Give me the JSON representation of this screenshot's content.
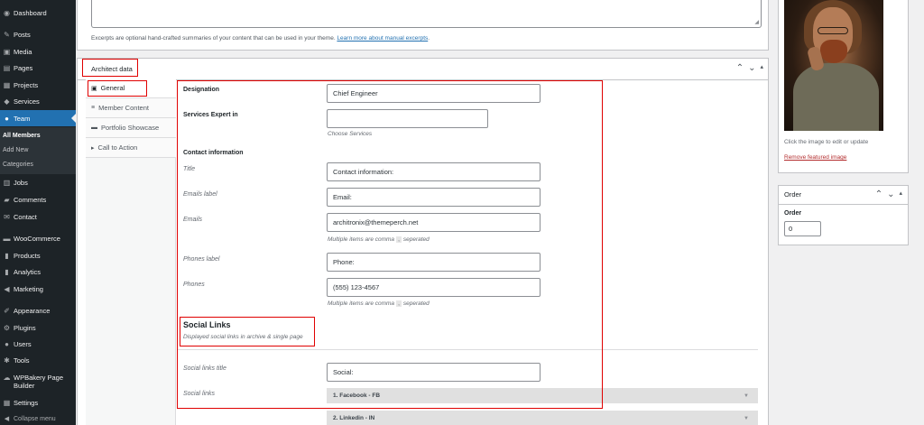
{
  "sidebar": {
    "items": [
      {
        "icon": "dashboard-icon",
        "glyph": "◉",
        "label": "Dashboard"
      },
      {
        "icon": "pin-icon",
        "glyph": "✎",
        "label": "Posts"
      },
      {
        "icon": "media-icon",
        "glyph": "▣",
        "label": "Media"
      },
      {
        "icon": "pages-icon",
        "glyph": "▤",
        "label": "Pages"
      },
      {
        "icon": "projects-icon",
        "glyph": "▦",
        "label": "Projects"
      },
      {
        "icon": "services-icon",
        "glyph": "◆",
        "label": "Services"
      },
      {
        "icon": "team-icon",
        "glyph": "●",
        "label": "Team"
      },
      {
        "icon": "jobs-icon",
        "glyph": "▥",
        "label": "Jobs"
      },
      {
        "icon": "comments-icon",
        "glyph": "▰",
        "label": "Comments"
      },
      {
        "icon": "contact-icon",
        "glyph": "✉",
        "label": "Contact"
      },
      {
        "icon": "woocommerce-icon",
        "glyph": "▬",
        "label": "WooCommerce"
      },
      {
        "icon": "products-icon",
        "glyph": "▮",
        "label": "Products"
      },
      {
        "icon": "analytics-icon",
        "glyph": "▮",
        "label": "Analytics"
      },
      {
        "icon": "marketing-icon",
        "glyph": "◀",
        "label": "Marketing"
      },
      {
        "icon": "appearance-icon",
        "glyph": "✐",
        "label": "Appearance"
      },
      {
        "icon": "plugins-icon",
        "glyph": "⚙",
        "label": "Plugins"
      },
      {
        "icon": "users-icon",
        "glyph": "●",
        "label": "Users"
      },
      {
        "icon": "tools-icon",
        "glyph": "✱",
        "label": "Tools"
      },
      {
        "icon": "wpbakery-icon",
        "glyph": "☁",
        "label": "WPBakery Page Builder"
      },
      {
        "icon": "settings-icon",
        "glyph": "▦",
        "label": "Settings"
      }
    ],
    "submenu": [
      "All Members",
      "Add New",
      "Categories"
    ],
    "collapse_label": "Collapse menu"
  },
  "excerpt": {
    "help_text": "Excerpts are optional hand-crafted summaries of your content that can be used in your theme.",
    "help_link": "Learn more about manual excerpts"
  },
  "metabox": {
    "title": "Architect data",
    "controls": [
      "⌃",
      "⌄",
      "▴"
    ]
  },
  "tabs": [
    {
      "icon": "general-icon",
      "glyph": "▣",
      "label": "General"
    },
    {
      "icon": "member-content-icon",
      "glyph": "≡",
      "label": "Member Content"
    },
    {
      "icon": "portfolio-icon",
      "glyph": "▬",
      "label": "Portfolio Showcase"
    },
    {
      "icon": "call-to-action-icon",
      "glyph": "▸",
      "label": "Call to Action"
    }
  ],
  "fields": {
    "designation_label": "Designation",
    "designation_value": "Chief Engineer",
    "services_label": "Services Expert in",
    "services_hint": "Choose Services",
    "contact_heading": "Contact information",
    "title_label": "Title",
    "title_value": "Contact information:",
    "emails_label_label": "Emails label",
    "emails_label_value": "Email:",
    "emails_label": "Emails",
    "emails_value": "architronix@themeperch.net",
    "emails_hint_pre": "Multiple items are comma",
    "emails_hint_key": ",",
    "emails_hint_post": "seperated",
    "phones_label_label": "Phones label",
    "phones_label_value": "Phone:",
    "phones_label": "Phones",
    "phones_value": "(555) 123-4567",
    "phones_hint_pre": "Multiple items are comma",
    "phones_hint_key": ",",
    "phones_hint_post": "seperated"
  },
  "social": {
    "heading": "Social Links",
    "subheading": "Displayed social links in archive & single page",
    "title_label": "Social links title",
    "title_value": "Social:",
    "links_label": "Social links",
    "items": [
      "1. Facebook - FB",
      "2. Linkedin - IN"
    ]
  },
  "featured_image": {
    "help": "Click the image to edit or update",
    "remove": "Remove featured image"
  },
  "order": {
    "title": "Order",
    "label": "Order",
    "value": "0",
    "controls": [
      "⌃",
      "⌄",
      "▴"
    ]
  }
}
